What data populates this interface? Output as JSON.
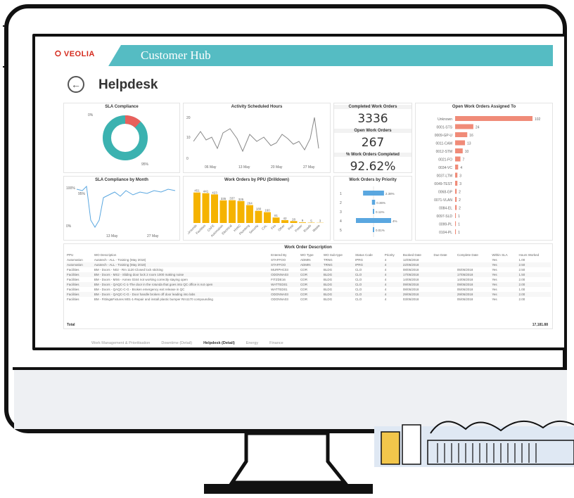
{
  "header": {
    "logo": "VEOLIA",
    "title": "Customer Hub"
  },
  "page": {
    "title": "Helpdesk"
  },
  "sla": {
    "title": "SLA Compliance",
    "label_small": "0%",
    "label_large": "95%",
    "pct_compliant": 0.95
  },
  "activity": {
    "title": "Activity Scheduled Hours",
    "ticks_x": [
      "06 May",
      "13 May",
      "20 May",
      "27 May"
    ],
    "ticks_y": [
      "20",
      "10",
      "0"
    ]
  },
  "kpi": {
    "completed_label": "Completed Work Orders",
    "completed_value": "3336",
    "open_label": "Open Work Orders",
    "open_value": "267",
    "pct_label": "% Work Orders Completed",
    "pct_value": "92.62%"
  },
  "assigned": {
    "title": "Open Work Orders Assigned To",
    "names": [
      "Unknown",
      "0001-STS",
      "0009-GP-U",
      "0011-CAM",
      "0012-STM",
      "0021-FO",
      "0034-VC",
      "0037-LTM",
      "0049-TEST",
      "0068-GP",
      "0071-VLAN",
      "0084-EL",
      "0097-SLD",
      "0099-PL",
      "0104-PL"
    ],
    "values": [
      102,
      24,
      16,
      13,
      10,
      7,
      4,
      3,
      3,
      2,
      2,
      2,
      1,
      1,
      1
    ]
  },
  "sla_month": {
    "title": "SLA Compliance by Month",
    "labels": [
      "100%",
      "95%",
      "0%",
      "13 May",
      "27 May"
    ]
  },
  "ppu": {
    "title": "Work Orders by PPU (Drilldown)",
    "categories": [
      "Grounds",
      "Facilities",
      "CAFE",
      "Automation",
      "Electrical",
      "HVAC",
      "Plumbing",
      "Security",
      "CAL",
      "Fire",
      "Other",
      "Pest",
      "Power",
      "Roads",
      "Waste"
    ],
    "values": [
      451,
      441,
      423,
      335,
      337,
      325,
      264,
      180,
      160,
      81,
      42,
      28,
      9,
      5,
      3
    ]
  },
  "priority": {
    "title": "Work Orders by Priority",
    "labels": [
      "1",
      "2",
      "3",
      "4",
      "5"
    ],
    "values": [
      2.38,
      0.36,
      0.11,
      4,
      0.01
    ]
  },
  "table": {
    "title": "Work Order Description",
    "headers": [
      "PPU",
      "WO Description",
      "Entered By",
      "WO Type",
      "WO Sub-type",
      "Status Code",
      "Priority",
      "Booked Date",
      "Due Date",
      "Complete Date",
      "Within SLA",
      "Hours Worked"
    ],
    "rows": [
      [
        "Automation",
        "Autotech - ALL - Training (May 2018)",
        "STAFFOO",
        "ADMIN",
        "TRNG",
        "IPRG",
        "4",
        "12/05/2018",
        "",
        "",
        "Yes",
        "1.00"
      ],
      [
        "Automation",
        "Autotech - ALL - Training (May 2018)",
        "STAFFOO",
        "ADMIN",
        "TRNG",
        "IPRG",
        "4",
        "22/05/2018",
        "",
        "",
        "Yes",
        "2.50"
      ],
      [
        "Facilities",
        "BM - Doors - N02 - Rm 1120 Closed lock sticking",
        "MURPHC03",
        "COR",
        "BLDG",
        "CLO",
        "4",
        "08/05/2018",
        "",
        "05/05/2018",
        "Yes",
        "2.50"
      ],
      [
        "Facilities",
        "BM - Doors - MS2 - Sliding door lock 2 room 1000 making noise",
        "ODONNA03",
        "COR",
        "BLDG",
        "CLO",
        "4",
        "17/05/2018",
        "",
        "17/05/2018",
        "Yes",
        "1.50"
      ],
      [
        "Facilities",
        "BM - Doors - MS6 - Annex 0344 not working correctly staying open",
        "FITZDE16",
        "COR",
        "BLDG",
        "CLO",
        "4",
        "14/05/2018",
        "",
        "14/05/2018",
        "Yes",
        "2.00"
      ],
      [
        "Facilities",
        "BM - Doors - QAQC-C-1-The door in the rotunda that goes into QC office is not open",
        "WATTED01",
        "COR",
        "BLDG",
        "CLO",
        "4",
        "09/05/2018",
        "",
        "09/05/2018",
        "Yes",
        "2.00"
      ],
      [
        "Facilities",
        "BM - Doors - QAQC-C-G - Broken emergency exit release in QC",
        "WATTED01",
        "COR",
        "BLDG",
        "CLO",
        "4",
        "08/05/2018",
        "",
        "05/05/2018",
        "Yes",
        "1.00"
      ],
      [
        "Facilities",
        "BM - Doors - QAQC-C-G - Door handle broken off door leading into labs",
        "ODONNA03",
        "COR",
        "BLDG",
        "CLO",
        "4",
        "29/05/2018",
        "",
        "29/05/2018",
        "Yes",
        "2.00"
      ],
      [
        "Facilities",
        "BM - Fitting&Fixtures M01-1-Repair and install plastic bumper Rm1170 compounding",
        "ODONNA03",
        "COR",
        "BLDG",
        "CLO",
        "4",
        "03/05/2018",
        "",
        "05/05/2018",
        "Yes",
        "2.00"
      ]
    ],
    "total_label": "Total",
    "total_value": "17,181.88"
  },
  "tabs": [
    "Work Management & Prioritisation",
    "Downtime (Detail)",
    "Helpdesk (Detail)",
    "Energy",
    "Finance"
  ],
  "active_tab": "Helpdesk (Detail)",
  "colors": {
    "teal": "#3bb2b0",
    "red": "#e8605c",
    "orange": "#f5b300",
    "blue": "#5aa7e0",
    "salmon": "#f08b78",
    "hub": "#55bcc3"
  }
}
